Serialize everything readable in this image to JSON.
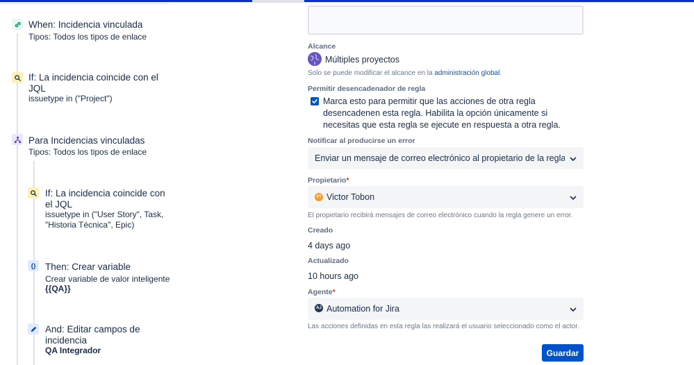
{
  "flow": {
    "steps": [
      {
        "title": "When: Incidencia vinculada",
        "sub": "Tipos: Todos los tipos de enlace",
        "icon": "link-icon"
      },
      {
        "title_l1": "If: La incidencia coincide con el",
        "title_l2": "JQL",
        "sub": "issuetype in (\"Project\")",
        "icon": "search-icon"
      },
      {
        "title": "Para Incidencias vinculadas",
        "sub": "Tipos: Todos los tipos de enlace",
        "icon": "branch-icon"
      },
      {
        "title_l1": "If: La incidencia coincide con",
        "title_l2": "el JQL",
        "sub_l1": "issuetype in (\"User Story\", Task,",
        "sub_l2": "\"Historia Técnica\", Epic)",
        "icon": "search-icon"
      },
      {
        "title": "Then: Crear variable",
        "sub": "Crear variable de valor inteligente",
        "bold": "{{QA}}",
        "icon": "braces-icon"
      },
      {
        "title_l1": "And: Editar campos de",
        "title_l2": "incidencia",
        "bold": "QA Integrador",
        "icon": "pencil-icon"
      }
    ]
  },
  "form": {
    "scope": {
      "label": "Alcance",
      "value": "Múltiples proyectos",
      "help_pre": "Solo se puede modificar el alcance en la ",
      "help_link": "administración global",
      "help_post": "."
    },
    "trigger": {
      "label": "Permitir desencadenador de regla",
      "checked": true,
      "text": "Marca esto para permitir que las acciones de otra regla desencadenen esta regla. Habilita la opción únicamente si necesitas que esta regla se ejecute en respuesta a otra regla."
    },
    "notify": {
      "label": "Notificar al producirse un error",
      "value": "Enviar un mensaje de correo electrónico al propietario de la regla una ve..."
    },
    "owner": {
      "label": "Propietario",
      "required_mark": "*",
      "avatar_initials": "VT",
      "value": "Victor Tobon",
      "help": "El propietario recibirá mensajes de correo electrónico cuando la regla genere un error."
    },
    "created": {
      "label": "Creado",
      "value": "4 days ago"
    },
    "updated": {
      "label": "Actualizado",
      "value": "10 hours ago"
    },
    "agent": {
      "label": "Agente",
      "required_mark": "*",
      "avatar_initials": "AJ",
      "value": "Automation for Jira",
      "help": "Las acciones definidas en esta regla las realizará el usuario seleccionado como el actor."
    },
    "save_label": "Guardar"
  },
  "colors": {
    "accent": "#0052cc",
    "top_bar": "#0b2bd6"
  }
}
